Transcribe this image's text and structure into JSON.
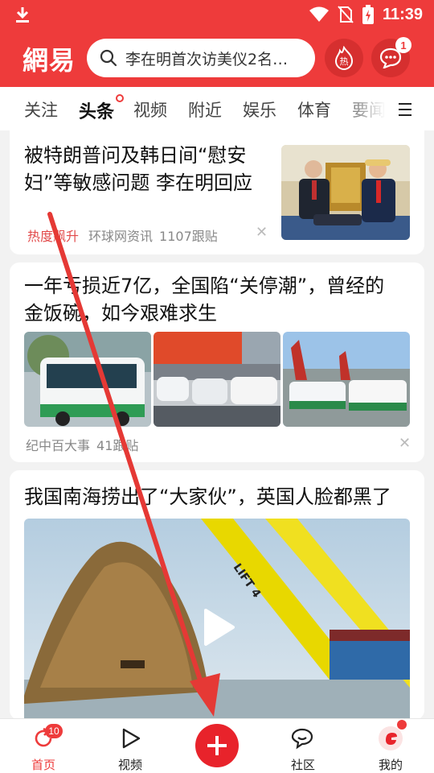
{
  "status_bar": {
    "time": "11:39"
  },
  "header": {
    "logo": "網易",
    "search_placeholder": "李在明首次访美仪2名…",
    "hot_icon_label": "热",
    "messages_badge": "1"
  },
  "tabs": [
    {
      "label": "关注"
    },
    {
      "label": "头条"
    },
    {
      "label": "视频"
    },
    {
      "label": "附近"
    },
    {
      "label": "娱乐"
    },
    {
      "label": "体育"
    },
    {
      "label": "要闻"
    }
  ],
  "feed": {
    "card1": {
      "title_line1": "被特朗普问及韩日间“慰安",
      "title_line2": "妇”等敏感问题 李在明回应",
      "hot_tag": "热度飙升",
      "source": "环球网资讯",
      "comments": "1107跟贴"
    },
    "card2": {
      "title_line1": "一年亏损近7亿，全国陷“关停潮”，曾经的",
      "title_line2": "金饭碗，如今艰难求生",
      "source": "纪中百大事",
      "comments": "41跟贴"
    },
    "card3": {
      "title": "我国南海捞出了“大家伙”，英国人脸都黑了",
      "crane_text": "LIFT 4"
    }
  },
  "bottom_nav": {
    "home": {
      "label": "首页",
      "badge": "10"
    },
    "video": {
      "label": "视频"
    },
    "community": {
      "label": "社区"
    },
    "me": {
      "label": "我的"
    }
  },
  "colors": {
    "brand_red": "#ee3b3b",
    "hot_tag": "#e24a4a",
    "annotation_arrow": "#e53935"
  },
  "icons": [
    "download-icon",
    "wifi-icon",
    "no-sim-icon",
    "battery-icon",
    "search-icon",
    "hot-icon",
    "message-icon",
    "close-icon",
    "menu-icon",
    "play-icon",
    "refresh-icon",
    "video-icon",
    "plus-icon",
    "community-icon",
    "avatar-icon"
  ]
}
